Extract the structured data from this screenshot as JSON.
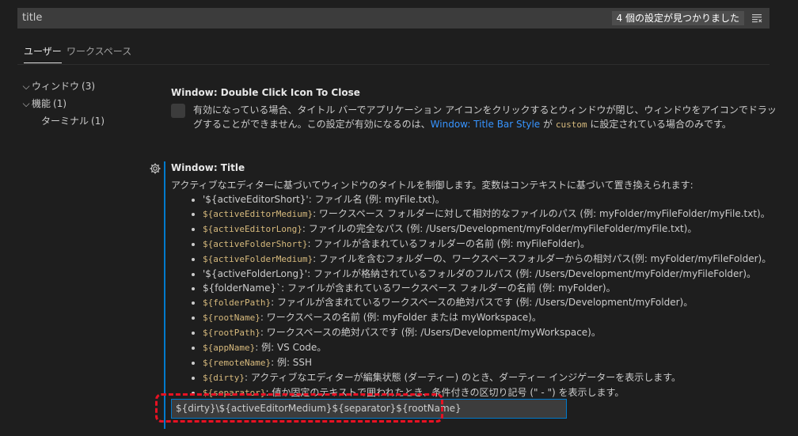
{
  "search": {
    "value": "title",
    "result_count": "4 個の設定が見つかりました",
    "clear_icon": "clear-filter-icon"
  },
  "tabs": [
    {
      "label": "ユーザー",
      "active": true
    },
    {
      "label": "ワークスペース",
      "active": false
    }
  ],
  "toc": [
    {
      "label": "ウィンドウ",
      "count": "(3)",
      "expanded": true
    },
    {
      "label": "機能",
      "count": "(1)",
      "expanded": true
    },
    {
      "label": "ターミナル",
      "count": "(1)"
    }
  ],
  "setting_double_click": {
    "category": "Window: ",
    "name": "Double Click Icon To Close",
    "desc_1": "有効になっている場合、タイトル バーでアプリケーション アイコンをクリックするとウィンドウが閉じ、ウィンドウをアイコンでドラッグすることができません。この設定が有効になるのは、",
    "link": "Window: Title Bar Style",
    "desc_2": " が ",
    "code": "custom",
    "desc_3": " に設定されている場合のみです。",
    "checked": false
  },
  "setting_title": {
    "category": "Window: ",
    "name": "Title",
    "description": "アクティブなエディターに基づいてウィンドウのタイトルを制御します。変数はコンテキストに基づいて置き換えられます:",
    "variables": [
      {
        "var": "",
        "plain": "'${activeEditorShort}': ファイル名 (例: myFile.txt)。"
      },
      {
        "var": "${activeEditorMedium}",
        "plain": ": ワークスペース フォルダーに対して相対的なファイルのパス (例: myFolder/myFileFolder/myFile.txt)。"
      },
      {
        "var": "${activeEditorLong}",
        "plain": ": ファイルの完全なパス (例: /Users/Development/myFolder/myFileFolder/myFile.txt)。"
      },
      {
        "var": "${activeFolderShort}",
        "plain": ": ファイルが含まれているフォルダーの名前 (例: myFileFolder)。"
      },
      {
        "var": "${activeFolderMedium}",
        "plain": ": ファイルを含むフォルダーの、ワークスペースフォルダーからの相対パス(例: myFolder/myFileFolder)。"
      },
      {
        "var": "",
        "plain": "'${activeFolderLong}': ファイルが格納されているフォルダのフルパス (例: /Users/Development/myFolder/myFileFolder)。"
      },
      {
        "var": "",
        "plain": "${folderName}`: ファイルが含まれているワークスペース フォルダーの名前 (例: myFolder)。"
      },
      {
        "var": "${folderPath}",
        "plain": ": ファイルが含まれているワークスペースの絶対パスです (例: /Users/Development/myFolder)。"
      },
      {
        "var": "${rootName}",
        "plain": ": ワークスペースの名前 (例: myFolder または myWorkspace)。"
      },
      {
        "var": "${rootPath}",
        "plain": ": ワークスペースの絶対パスです (例: /Users/Development/myWorkspace)。"
      },
      {
        "var": "${appName}",
        "plain": ": 例: VS Code。"
      },
      {
        "var": "${remoteName}",
        "plain": ": 例: SSH"
      },
      {
        "var": "${dirty}",
        "plain": ": アクティブなエディターが編集状態 (ダーティー) のとき、ダーティー インジゲーターを表示します。"
      },
      {
        "var": "${separator}",
        "plain": ": 値か固定のテキストで囲われたとき、条件付きの区切り記号 (\" - \") を表示します。"
      }
    ],
    "value": "${dirty}\\${activeEditorMedium}${separator}${rootName}",
    "gear_icon": "gear-icon"
  },
  "colors": {
    "background": "#1e1e1e",
    "accent": "#007acc",
    "link": "#3794ff",
    "code": "#d7ba7d",
    "annotation": "#e81123"
  }
}
